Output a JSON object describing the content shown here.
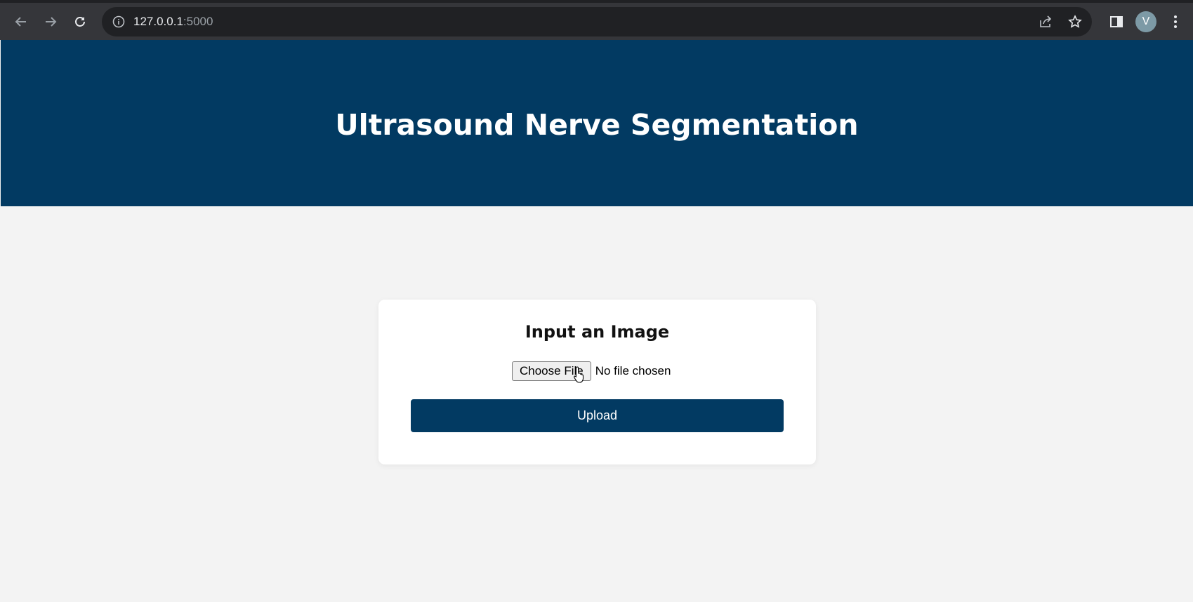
{
  "browser": {
    "url_host": "127.0.0.1",
    "url_port": ":5000",
    "avatar_initial": "V",
    "icons": [
      "back-arrow-icon",
      "forward-arrow-icon",
      "reload-icon",
      "info-icon",
      "share-icon",
      "star-icon",
      "side-panel-icon",
      "avatar",
      "kebab-menu-icon"
    ]
  },
  "header": {
    "title": "Ultrasound Nerve Segmentation",
    "background": "#023a62"
  },
  "upload_card": {
    "heading": "Input an Image",
    "choose_file_label": "Choose File",
    "file_status": "No file chosen",
    "upload_label": "Upload",
    "accent": "#023a62"
  }
}
